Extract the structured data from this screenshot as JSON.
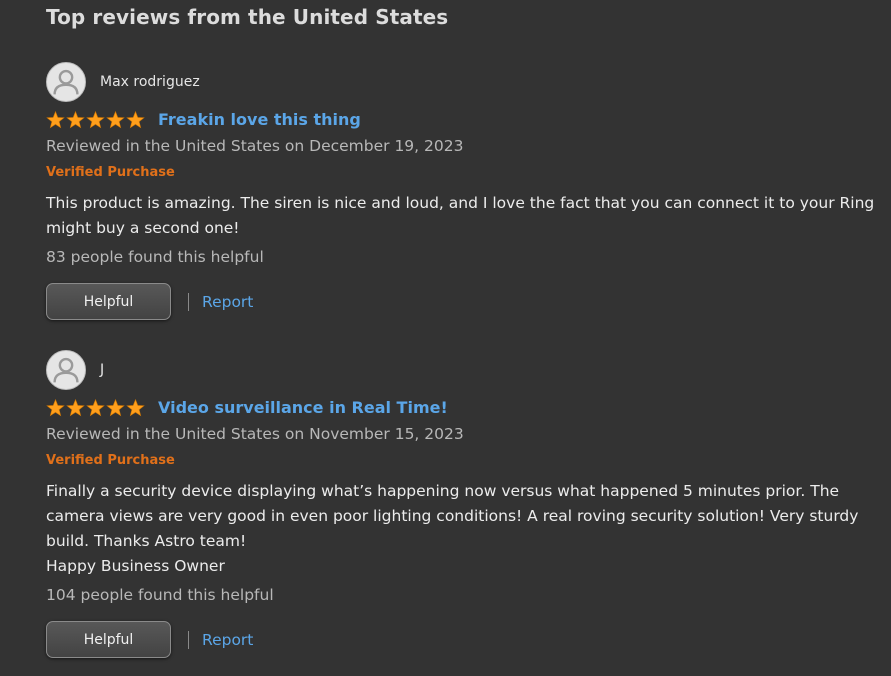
{
  "heading": "Top reviews from the United States",
  "colors": {
    "background": "#333333",
    "link": "#5ba6e8",
    "verified": "#e0701a",
    "star": "#ff9f1c"
  },
  "reviews": [
    {
      "author": "Max rodriguez",
      "rating": 5,
      "title": "Freakin love this thing",
      "date": "Reviewed in the United States on December 19, 2023",
      "verified": "Verified Purchase",
      "body": [
        "This product is amazing. The siren is nice and loud, and I love the fact that you can connect it to your Ring\nmight buy a second one!"
      ],
      "helpful_count": "83 people found this helpful",
      "helpful_button": "Helpful",
      "report_link": "Report"
    },
    {
      "author": "J",
      "rating": 5,
      "title": "Video surveillance in Real Time!",
      "date": "Reviewed in the United States on November 15, 2023",
      "verified": "Verified Purchase",
      "body": [
        "Finally a security device displaying what’s happening now versus what happened 5 minutes prior. The\ncamera views are very good in even poor lighting conditions! A real roving security solution! Very sturdy\nbuild. Thanks Astro team!",
        "Happy Business Owner"
      ],
      "helpful_count": "104 people found this helpful",
      "helpful_button": "Helpful",
      "report_link": "Report"
    }
  ]
}
